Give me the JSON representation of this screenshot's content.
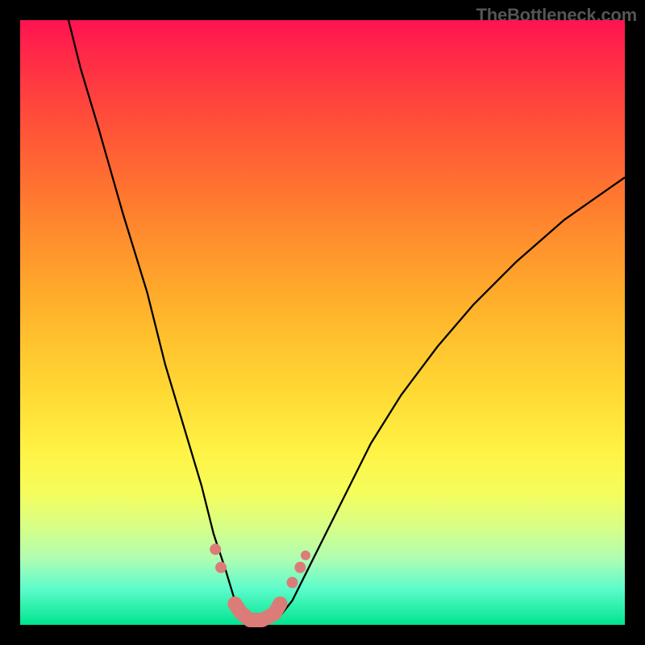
{
  "watermark": "TheBottleneck.com",
  "chart_data": {
    "type": "line",
    "title": "",
    "xlabel": "",
    "ylabel": "",
    "xlim": [
      0,
      100
    ],
    "ylim": [
      0,
      100
    ],
    "grid": false,
    "series": [
      {
        "name": "bottleneck-curve",
        "color": "#000000",
        "x": [
          8,
          10,
          13,
          17,
          21,
          24,
          27,
          30,
          32,
          34,
          35.5,
          37,
          39,
          41,
          43,
          45,
          47,
          50,
          54,
          58,
          63,
          69,
          75,
          82,
          90,
          100
        ],
        "values": [
          100,
          92,
          82,
          68,
          55,
          43,
          33,
          23,
          15,
          9,
          4,
          1,
          0,
          0.2,
          1.5,
          4,
          8,
          14,
          22,
          30,
          38,
          46,
          53,
          60,
          67,
          74
        ]
      }
    ],
    "annotations": [
      {
        "name": "valley-worm",
        "type": "polyline",
        "color": "#db7c78",
        "x": [
          35.5,
          36.5,
          38,
          40,
          42,
          43
        ],
        "values": [
          3.5,
          2,
          0.8,
          0.8,
          1.8,
          3.5
        ]
      },
      {
        "name": "bead-left-upper",
        "type": "point",
        "color": "#db7c78",
        "x": 32.3,
        "value": 12.5,
        "r": 7
      },
      {
        "name": "bead-left-lower",
        "type": "point",
        "color": "#db7c78",
        "x": 33.2,
        "value": 9.5,
        "r": 7
      },
      {
        "name": "bead-right-lower",
        "type": "point",
        "color": "#db7c78",
        "x": 45.0,
        "value": 7.0,
        "r": 7
      },
      {
        "name": "bead-right-mid",
        "type": "point",
        "color": "#db7c78",
        "x": 46.3,
        "value": 9.5,
        "r": 7
      },
      {
        "name": "bead-right-upper",
        "type": "point",
        "color": "#db7c78",
        "x": 47.2,
        "value": 11.5,
        "r": 6
      }
    ],
    "background": {
      "type": "vertical-gradient",
      "stops": [
        {
          "pos": 0,
          "color": "#ff1350"
        },
        {
          "pos": 50,
          "color": "#ffc22e"
        },
        {
          "pos": 75,
          "color": "#fff244"
        },
        {
          "pos": 100,
          "color": "#00e48f"
        }
      ]
    }
  }
}
